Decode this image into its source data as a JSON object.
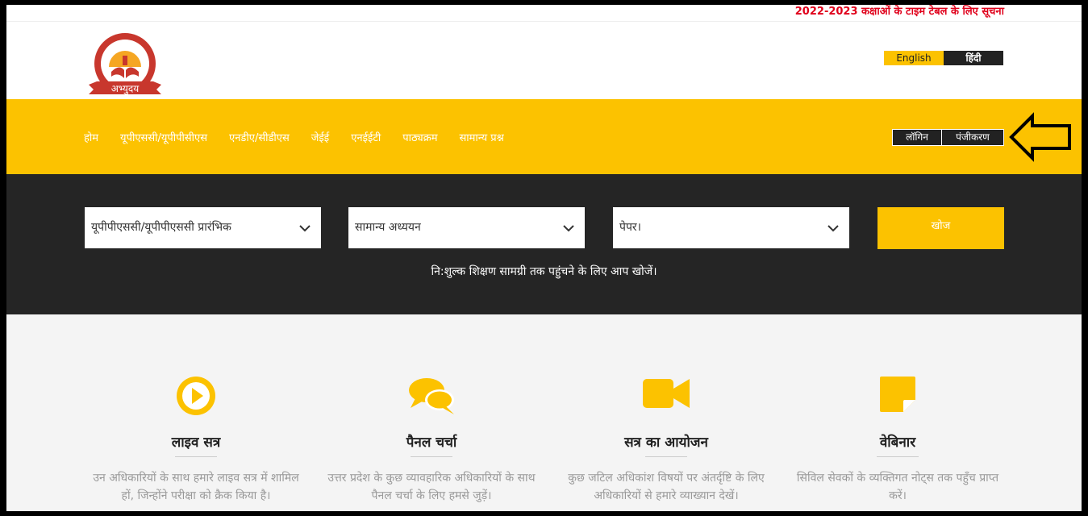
{
  "ticker": {
    "text": "2022-2023 कक्षाओं के टाइम टेबल के लिए सूचना"
  },
  "logo": {
    "text": "अभ्युदय",
    "arc_text": "तेजस्विनावधीतमस्तु"
  },
  "language": {
    "english": "English",
    "hindi": "हिंदी"
  },
  "nav": {
    "items": [
      "होम",
      "यूपीएससी/यूपीपीसीएस",
      "एनडीए/सीडीएस",
      "जेईई",
      "एनईईटी",
      "पाठ्यक्रम",
      "सामान्य प्रश्न"
    ],
    "login": "लॉगिन",
    "register": "पंजीकरण"
  },
  "search": {
    "exam": "यूपीपीएससी/यूपीपीएससी प्रारंभिक",
    "subject": "सामान्य अध्ययन",
    "paper": "पेपर।",
    "button": "खोज",
    "caption": "नि:शुल्क शिक्षण सामग्री तक पहुंचने के लिए आप खोजें।"
  },
  "features": [
    {
      "icon": "play-circle-icon",
      "title": "लाइव सत्र",
      "text": "उन अधिकारियों के साथ हमारे लाइव सत्र में शामिल हों, जिन्होंने परीक्षा को क्रैक किया है।"
    },
    {
      "icon": "chat-bubbles-icon",
      "title": "पैनल चर्चा",
      "text": "उत्तर प्रदेश के कुछ व्यावहारिक अधिकारियों के साथ पैनल चर्चा के लिए हमसे जुड़ें।"
    },
    {
      "icon": "video-camera-icon",
      "title": "सत्र का आयोजन",
      "text": "कुछ जटिल अधिकांश विषयों पर अंतर्दृष्टि के लिए अधिकारियों से हमारे व्याख्यान देखें।"
    },
    {
      "icon": "sticky-note-icon",
      "title": "वेबिनार",
      "text": "सिविल सेवकों के व्यक्तिगत नोट्स तक पहुँच प्राप्त करें।"
    }
  ],
  "colors": {
    "accent": "#fcc200",
    "dark": "#252525",
    "ticker": "#e0001b"
  }
}
